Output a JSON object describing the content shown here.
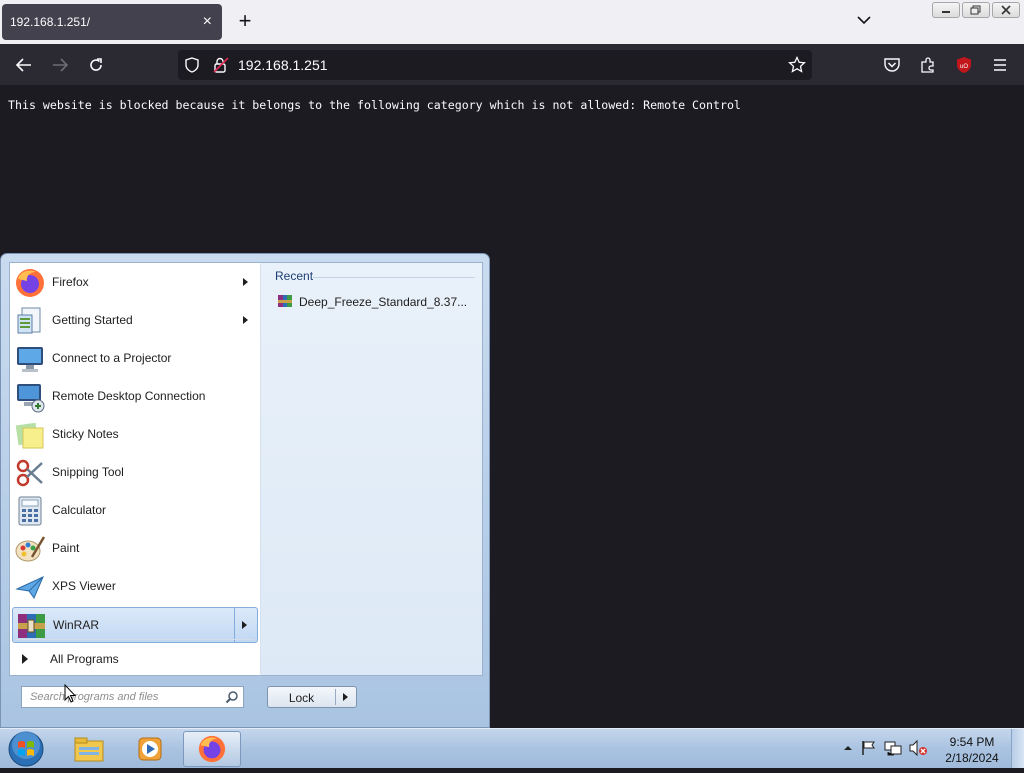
{
  "browser": {
    "tab": {
      "title": "192.168.1.251/"
    },
    "url": "192.168.1.251",
    "page_text": "This website is blocked because it belongs to the following category which is not allowed: Remote Control"
  },
  "start_menu": {
    "programs": [
      {
        "label": "Firefox",
        "icon": "firefox-icon",
        "has_submenu": true
      },
      {
        "label": "Getting Started",
        "icon": "getting-started-icon",
        "has_submenu": true
      },
      {
        "label": "Connect to a Projector",
        "icon": "projector-icon",
        "has_submenu": false
      },
      {
        "label": "Remote Desktop Connection",
        "icon": "remote-desktop-icon",
        "has_submenu": false
      },
      {
        "label": "Sticky Notes",
        "icon": "sticky-notes-icon",
        "has_submenu": false
      },
      {
        "label": "Snipping Tool",
        "icon": "snipping-tool-icon",
        "has_submenu": false
      },
      {
        "label": "Calculator",
        "icon": "calculator-icon",
        "has_submenu": false
      },
      {
        "label": "Paint",
        "icon": "paint-icon",
        "has_submenu": false
      },
      {
        "label": "XPS Viewer",
        "icon": "xps-viewer-icon",
        "has_submenu": false
      },
      {
        "label": "WinRAR",
        "icon": "winrar-icon",
        "has_submenu": true,
        "selected": true
      }
    ],
    "all_programs": "All Programs",
    "recent_header": "Recent",
    "recent_items": [
      {
        "label": "Deep_Freeze_Standard_8.37...",
        "icon": "winrar-archive-icon"
      }
    ],
    "search_placeholder": "Search programs and files",
    "lock_label": "Lock"
  },
  "taskbar": {
    "pinned": [
      "explorer-icon",
      "media-player-icon",
      "firefox-icon"
    ],
    "active": "firefox-icon",
    "clock_time": "9:54 PM",
    "clock_date": "2/18/2024"
  },
  "colors": {
    "page_bg": "#1c1b22",
    "toolbar_bg": "#2b2a33",
    "tab_bg": "#42414d",
    "ublock_red": "#c0161c"
  }
}
